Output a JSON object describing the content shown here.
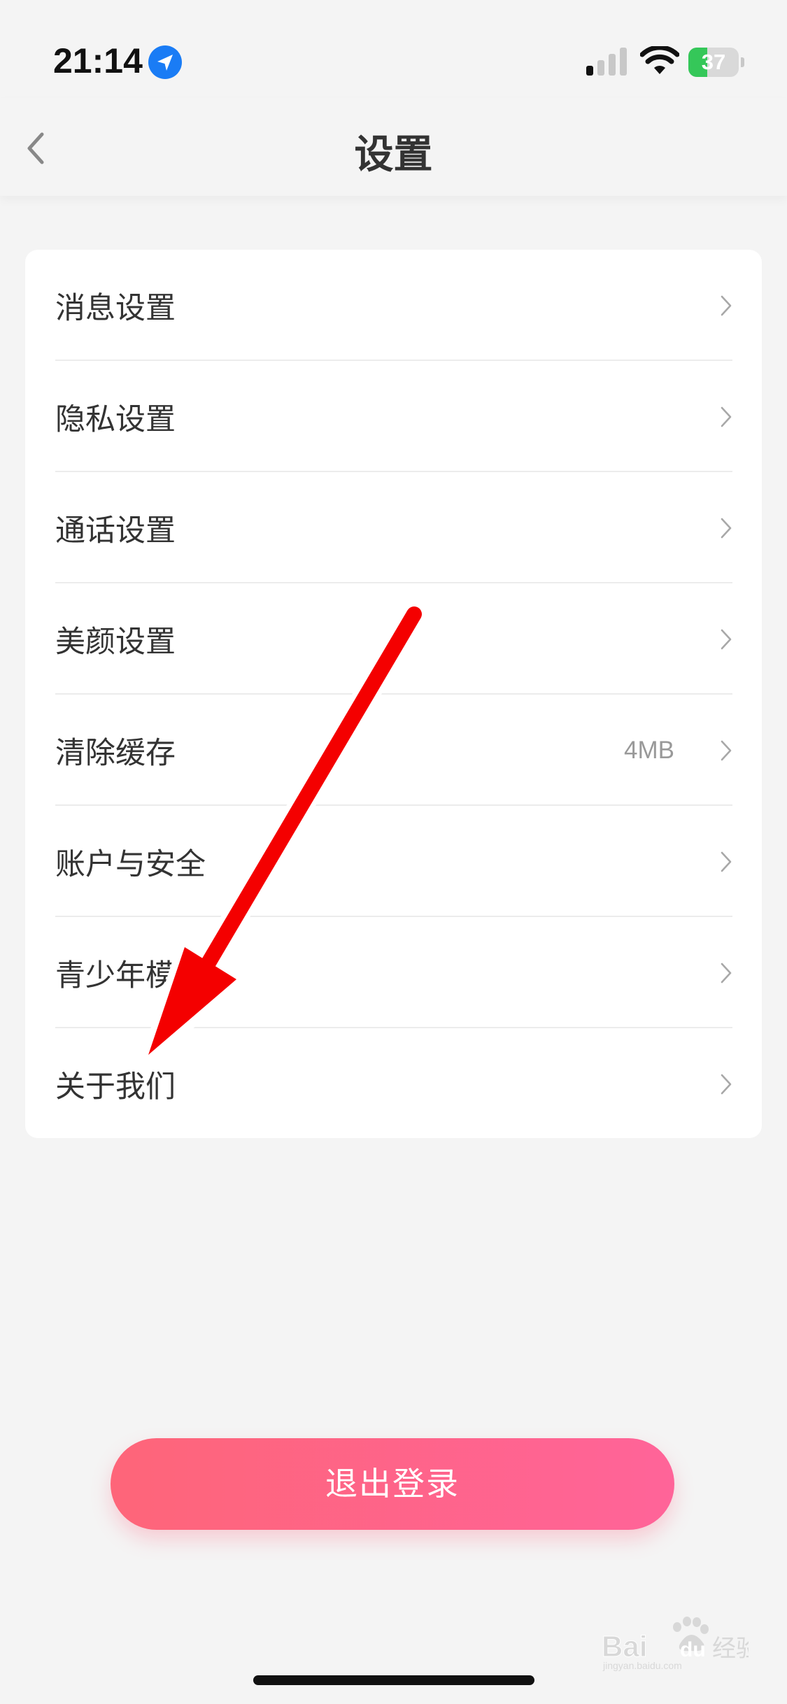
{
  "status_bar": {
    "time": "21:14",
    "battery_percent": 37,
    "battery_label": "37"
  },
  "nav": {
    "title": "设置"
  },
  "settings": {
    "items": [
      {
        "label": "消息设置",
        "value": ""
      },
      {
        "label": "隐私设置",
        "value": ""
      },
      {
        "label": "通话设置",
        "value": ""
      },
      {
        "label": "美颜设置",
        "value": ""
      },
      {
        "label": "清除缓存",
        "value": "4MB"
      },
      {
        "label": "账户与安全",
        "value": ""
      },
      {
        "label": "青少年模式",
        "value": ""
      },
      {
        "label": "关于我们",
        "value": ""
      }
    ]
  },
  "logout": {
    "label": "退出登录"
  },
  "watermark": {
    "text": "Baidu经验",
    "subtext": "jingyan.baidu.com"
  },
  "colors": {
    "accent_start": "#fe6579",
    "accent_end": "#ff6499",
    "annotation": "#f40000",
    "battery_green": "#35c759",
    "location_blue": "#1a7cf5"
  },
  "icons": [
    "location-arrow-icon",
    "cellular-signal-icon",
    "wifi-icon",
    "battery-icon",
    "back-chevron-icon",
    "chevron-right-icon",
    "annotation-arrow"
  ]
}
